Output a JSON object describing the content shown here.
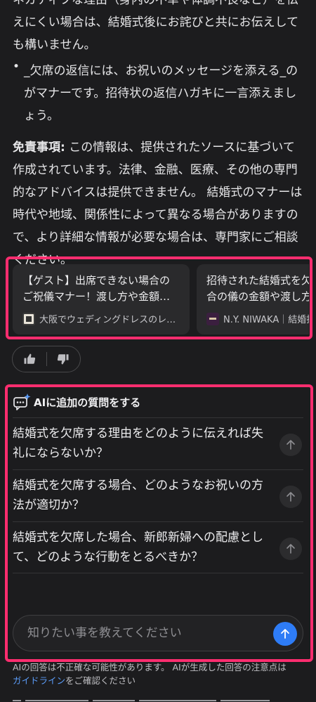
{
  "answer": {
    "paragraph1": "ネガティブな理由（身内の不幸や体調不良など）を伝えにくい場合は、結婚式後にお詫びと共にお伝えしても構いません。",
    "bullet": "•",
    "paragraph2": "_欠席の返信には、お祝いのメッセージを添える_のがマナーです。招待状の返信ハガキに一言添えましょう。",
    "disclaimer_label": "免責事項:",
    "disclaimer_text": " この情報は、提供されたソースに基づいて作成されています。法律、金融、医療、その他の専門的なアドバイスは提供できません。 結婚式のマナーは時代や地域、関係性によって異なる場合がありますので、より詳細な情報が必要な場合は、専門家にご相談ください。"
  },
  "sources": [
    {
      "title": "【ゲスト】出席できない場合のご祝儀マナー！渡し方や金額…",
      "site": "大阪でウェディングドレスのレ…",
      "favicon": "castle-logo-icon"
    },
    {
      "title": "招待された結婚式を欠席する場合の儀の金額や渡し方はどうする…",
      "site": "N.Y. NIWAKA｜結婚指輪",
      "favicon": "niwaka-logo-icon"
    }
  ],
  "feedback": {
    "like_icon": "thumbs-up-icon",
    "dislike_icon": "thumbs-down-icon"
  },
  "followup": {
    "title": "AIに追加の質問をする",
    "questions": [
      "結婚式を欠席する理由をどのように伝えれば失礼にならないか？",
      "結婚式を欠席する場合、どのようなお祝いの方法が適切か？",
      "結婚式を欠席した場合、新郎新婦への配慮として、どのような行動をとるべきか？"
    ]
  },
  "input": {
    "placeholder": "知りたい事を教えてください",
    "value": ""
  },
  "notice": {
    "text1": "AIの回答は不正確な可能性があります。 AIが生成した回答の注意点は",
    "link": "ガイドライン",
    "text2": "をご確認ください"
  },
  "colors": {
    "highlight": "#ff2d6f",
    "accent": "#2e7cf6",
    "link": "#5b9cf8",
    "background": "#1c1c1e"
  }
}
